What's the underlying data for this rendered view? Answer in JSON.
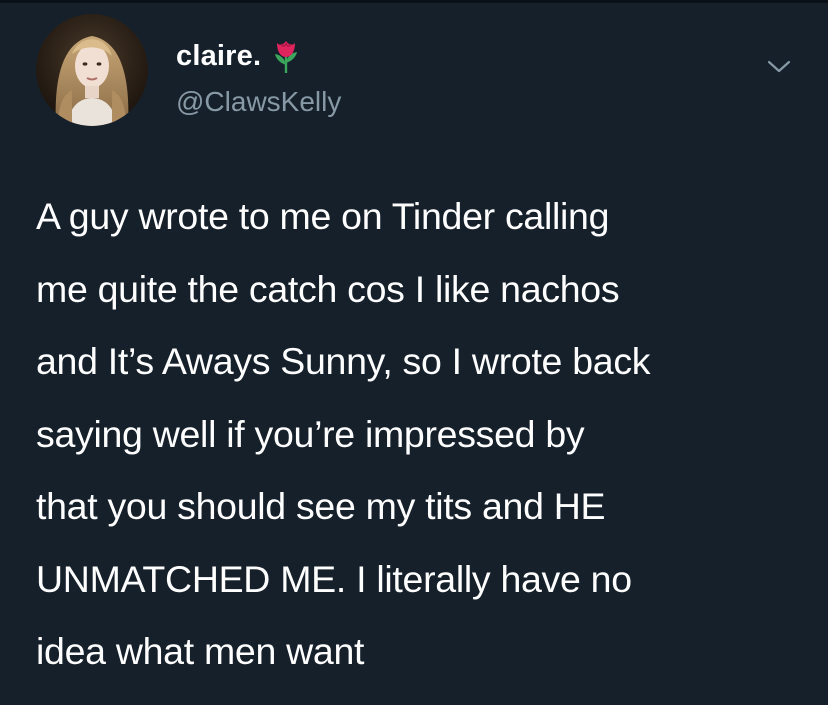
{
  "tweet": {
    "author": {
      "display_name": "claire.",
      "emoji": "rose-icon",
      "handle": "@ClawsKelly",
      "avatar": "profile-photo"
    },
    "menu_icon": "chevron-down-icon",
    "text_lines": [
      "A guy wrote to me on Tinder calling",
      "me quite the catch cos I like nachos",
      "and It’s Aways Sunny, so I wrote back",
      "saying well if you’re impressed by",
      "that you should see my tits and HE",
      "UNMATCHED ME. I literally have no",
      "idea what men want"
    ]
  },
  "colors": {
    "background": "#15202b",
    "text": "#ffffff",
    "secondary_text": "#8899a6",
    "rose": "#e0245e",
    "leaf": "#3aa55b"
  }
}
